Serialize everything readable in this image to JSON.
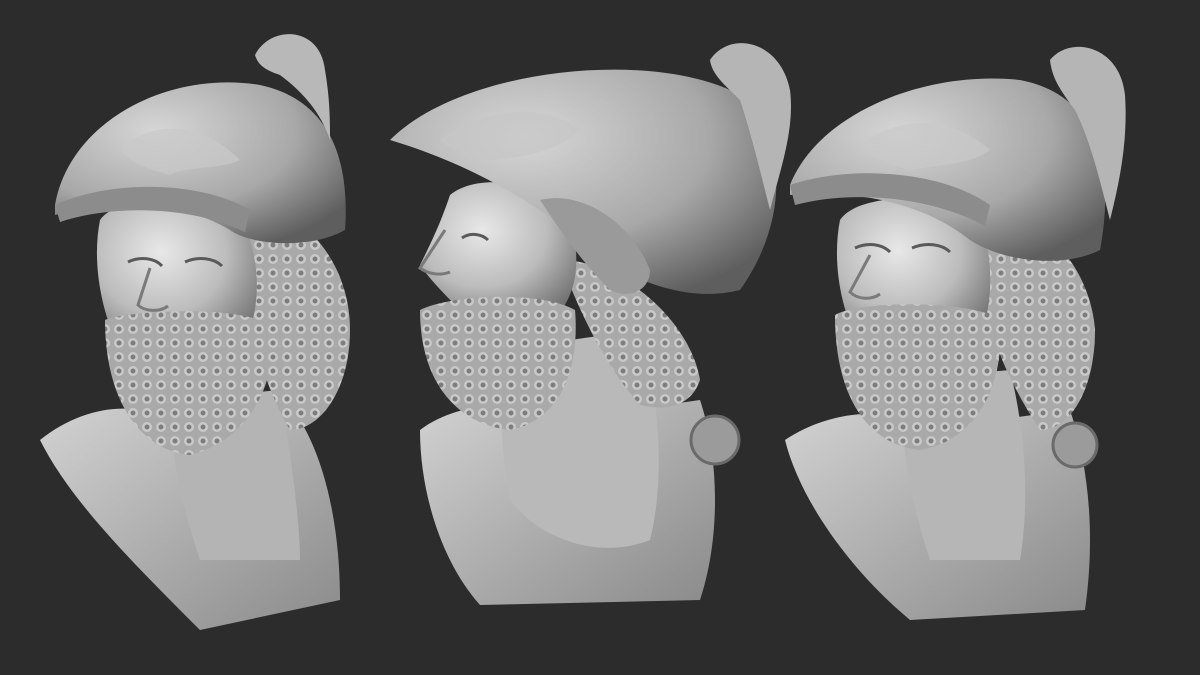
{
  "scene": {
    "background_color": "#2c2c2c",
    "material_color": "#bdbdbd",
    "shadow_color": "#6a6a6a",
    "highlight_color": "#e4e4e4",
    "views": [
      {
        "id": "three-quarter-left"
      },
      {
        "id": "profile-left"
      },
      {
        "id": "three-quarter-left-alt"
      }
    ]
  }
}
